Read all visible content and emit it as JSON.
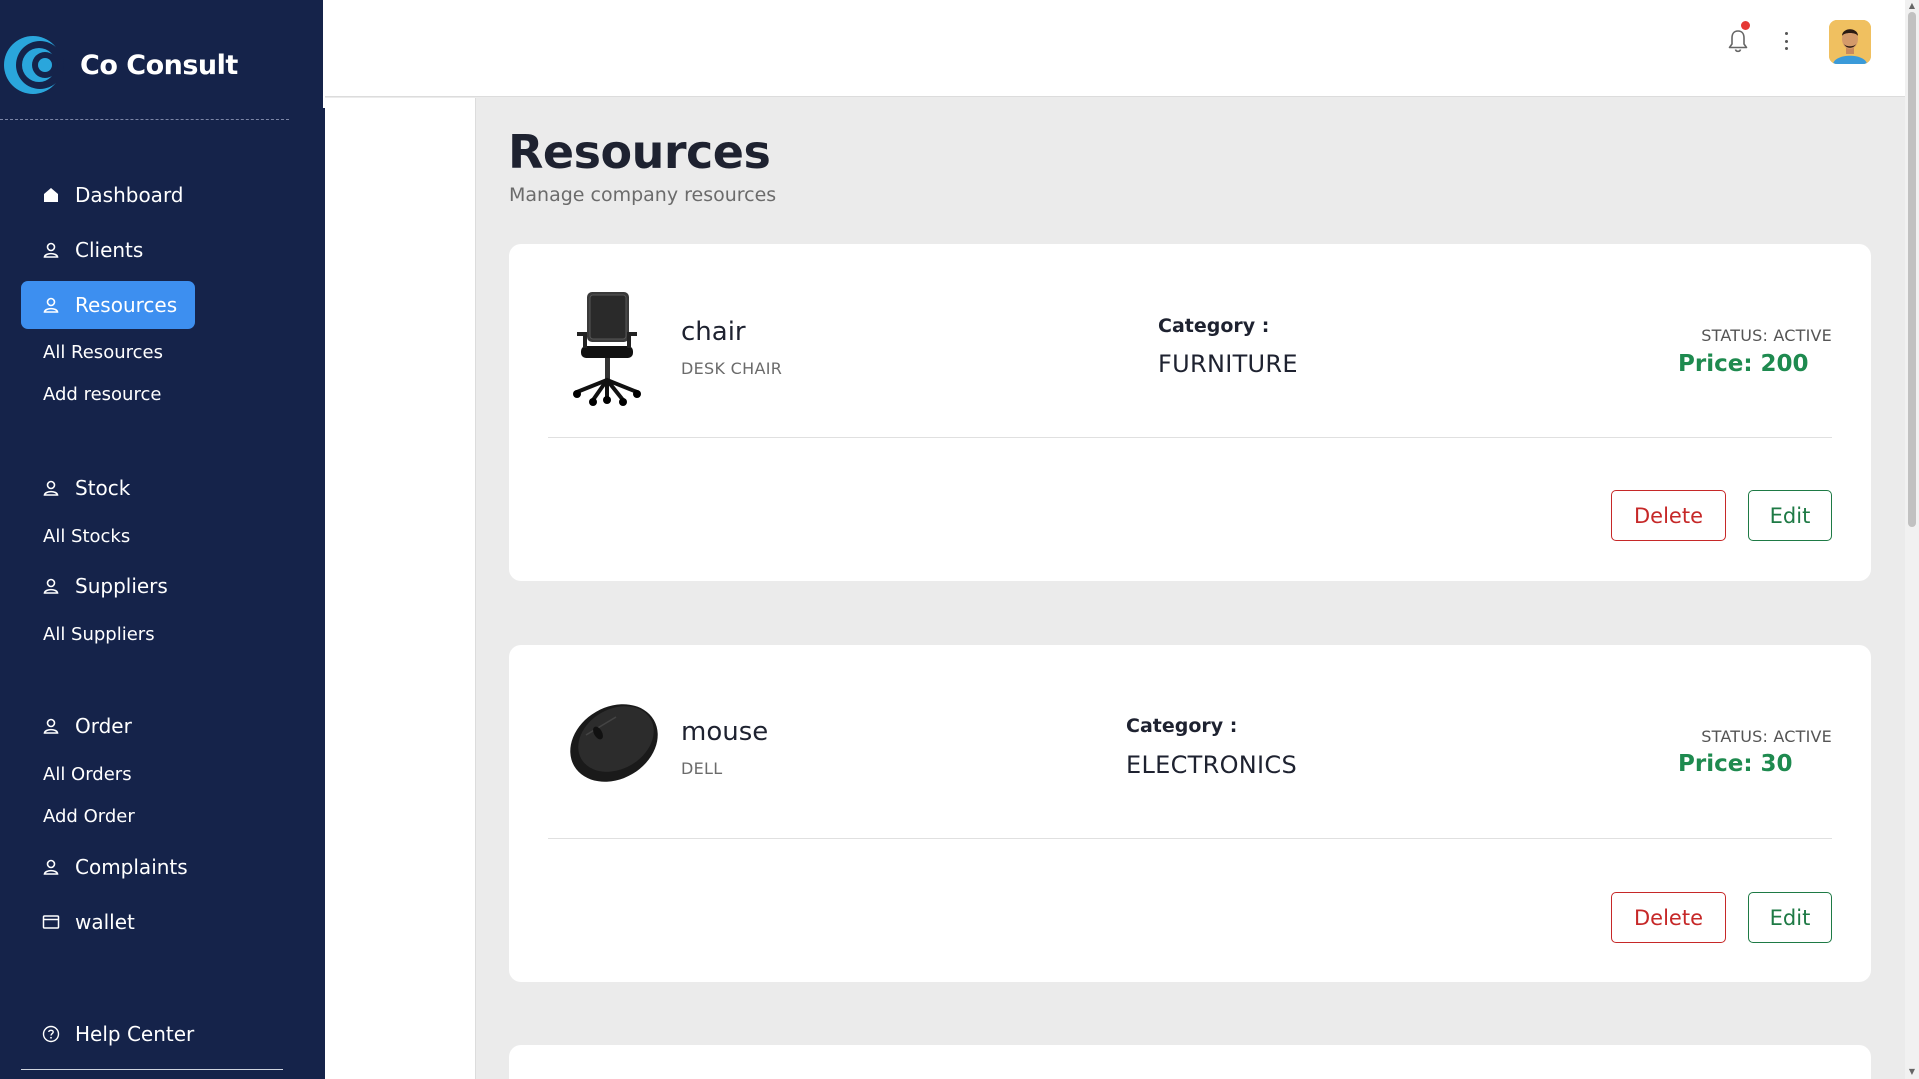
{
  "brand": {
    "name": "Co Consult"
  },
  "nav": {
    "dashboard": "Dashboard",
    "clients": "Clients",
    "resources": "Resources",
    "all_resources": "All Resources",
    "add_resource": "Add resource",
    "stock": "Stock",
    "all_stocks": "All Stocks",
    "suppliers": "Suppliers",
    "all_suppliers": "All Suppliers",
    "order": "Order",
    "all_orders": "All Orders",
    "add_order": "Add Order",
    "complaints": "Complaints",
    "wallet": "wallet",
    "help_center": "Help Center"
  },
  "header": {
    "title": "Resources",
    "subtitle": "Manage company resources"
  },
  "resources": [
    {
      "name": "chair",
      "subtitle": "DESK CHAIR",
      "category_label": "Category :",
      "category": "FURNITURE",
      "status": "STATUS: ACTIVE",
      "price_label": "Price:",
      "price": "200",
      "delete_label": "Delete",
      "edit_label": "Edit"
    },
    {
      "name": "mouse",
      "subtitle": "DELL",
      "category_label": "Category :",
      "category": "ELECTRONICS",
      "status": "STATUS: ACTIVE",
      "price_label": "Price:",
      "price": "30",
      "delete_label": "Delete",
      "edit_label": "Edit"
    }
  ],
  "icons": {
    "nav": [
      "home-icon",
      "user-icon",
      "wallet-icon",
      "help-icon"
    ],
    "topbar": [
      "bell-icon",
      "more-vertical-icon",
      "avatar"
    ]
  },
  "colors": {
    "sidebar": "#15234a",
    "active": "#3d8ff0",
    "price": "#1e8a4f",
    "delete": "#c62828",
    "edit": "#1e7a45",
    "notification_dot": "#e53935"
  }
}
